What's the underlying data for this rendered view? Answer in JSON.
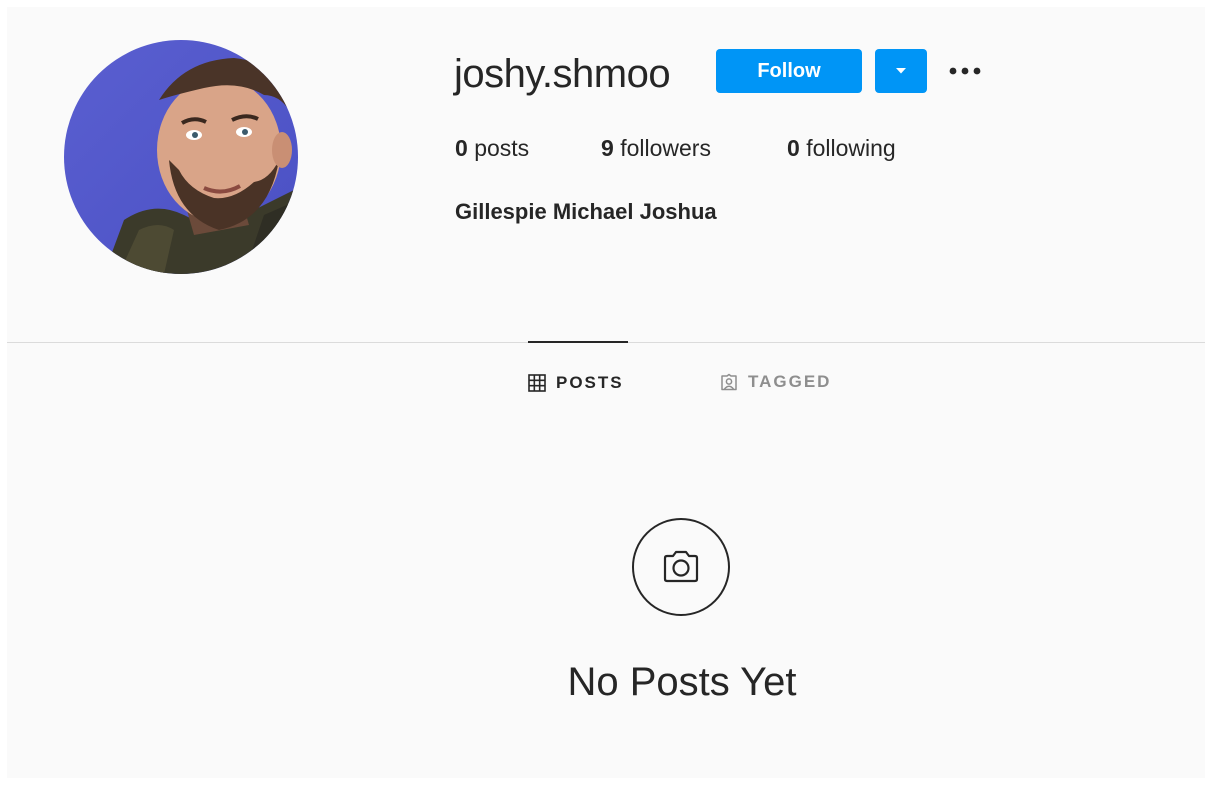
{
  "profile": {
    "username": "joshy.shmoo",
    "full_name": "Gillespie Michael Joshua",
    "avatar_icon": "profile-photo-avatar"
  },
  "actions": {
    "follow_label": "Follow",
    "dropdown_icon": "caret-down-icon",
    "more_icon": "more-options-icon",
    "accent_color": "#0095f6"
  },
  "stats": {
    "posts": {
      "count": "0",
      "label": "posts"
    },
    "followers": {
      "count": "9",
      "label": "followers"
    },
    "following": {
      "count": "0",
      "label": "following"
    }
  },
  "tabs": [
    {
      "label": "POSTS",
      "icon": "grid-icon",
      "active": true
    },
    {
      "label": "TAGGED",
      "icon": "tagged-icon",
      "active": false
    }
  ],
  "empty_state": {
    "icon": "camera-icon",
    "title": "No Posts Yet"
  }
}
